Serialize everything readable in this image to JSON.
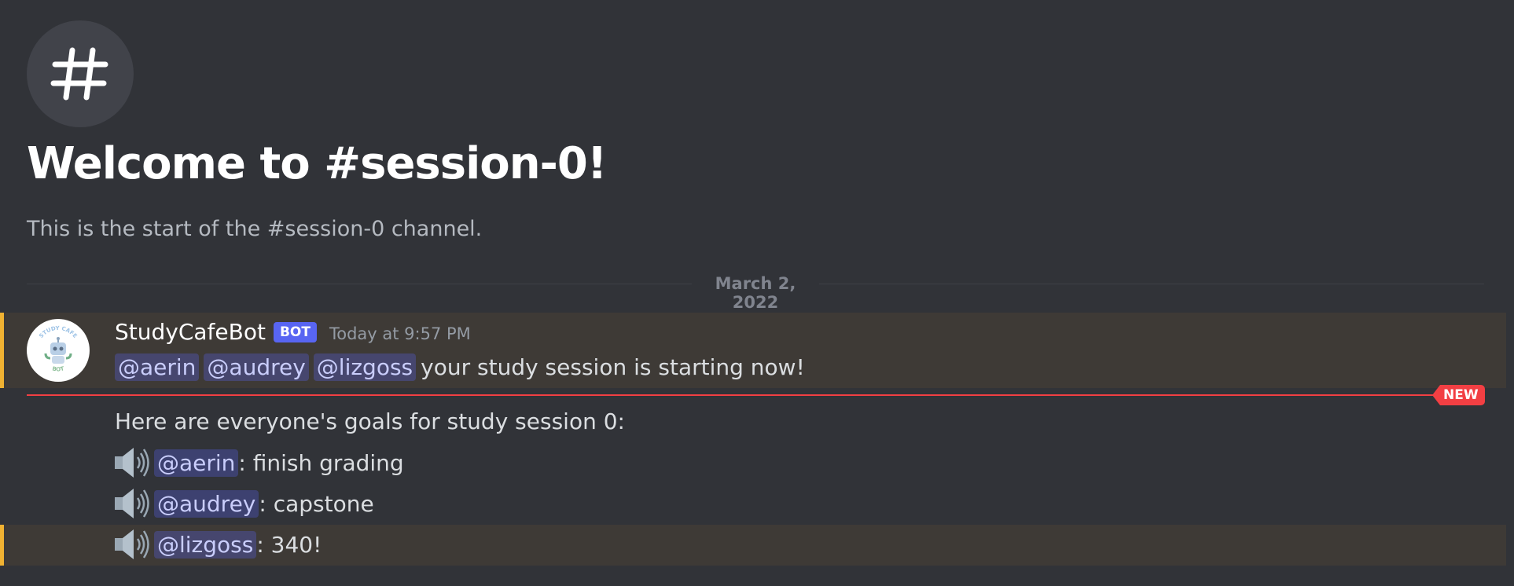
{
  "channel": {
    "icon": "hashtag-icon",
    "welcome_title": "Welcome to #session-0!",
    "welcome_subtitle": "This is the start of the #session-0 channel."
  },
  "date_divider": "March 2, 2022",
  "message": {
    "author": "StudyCafeBot",
    "bot_tag": "BOT",
    "timestamp": "Today at 9:57 PM",
    "avatar_text_top": "STUDY CAFE",
    "avatar_text_bottom": "BOT",
    "line1": {
      "mentions": [
        "@aerin",
        "@audrey",
        "@lizgoss"
      ],
      "text": "your study session is starting now!"
    },
    "new_badge": "NEW",
    "line2": "Here are everyone's goals for study session 0:",
    "goals": [
      {
        "icon": "speaker-icon",
        "mention": "@aerin",
        "text": ": finish grading"
      },
      {
        "icon": "speaker-icon",
        "mention": "@audrey",
        "text": ": capstone"
      },
      {
        "icon": "speaker-icon",
        "mention": "@lizgoss",
        "text": ": 340!"
      }
    ]
  },
  "colors": {
    "background": "#313338",
    "highlight": "#3e3a36",
    "highlight_bar": "#f0b232",
    "new_line": "#f23f43",
    "bot_tag": "#5865f2",
    "mention_bg": "#3c4270"
  }
}
